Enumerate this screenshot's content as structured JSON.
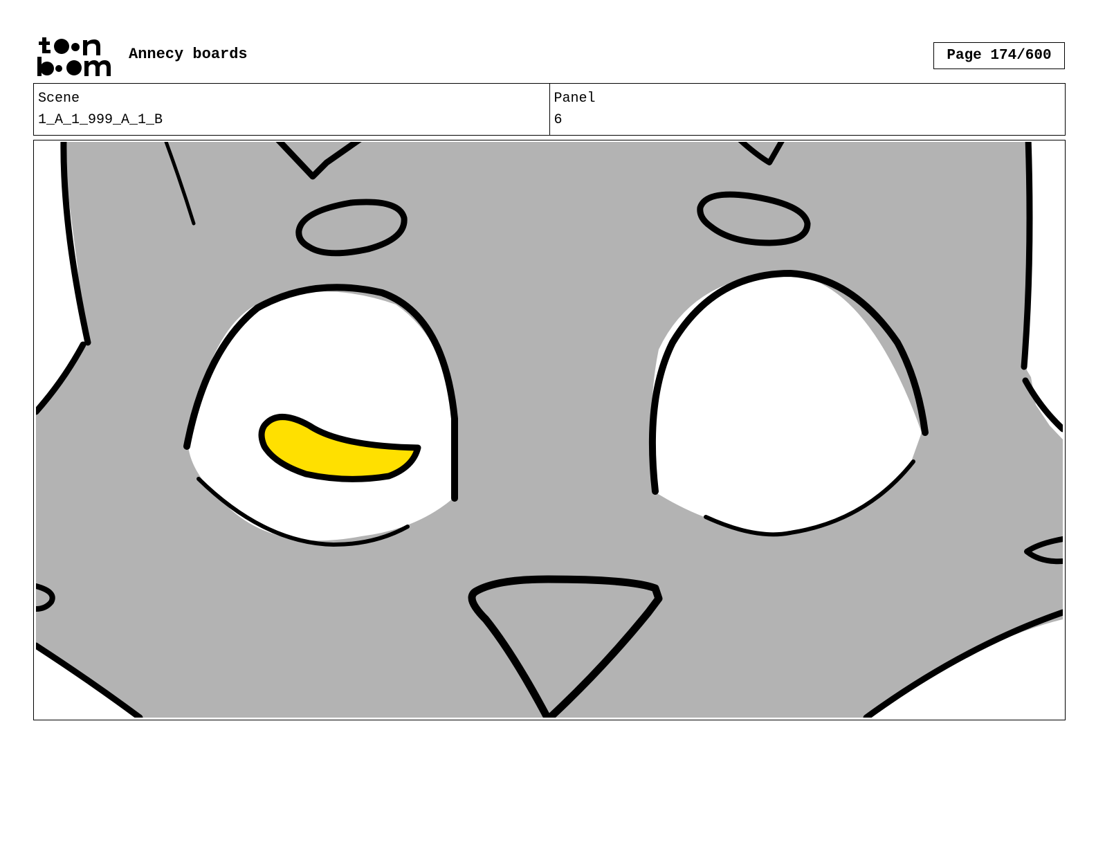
{
  "header": {
    "logo_text": "toonboom",
    "app_title": "Annecy boards",
    "page_label": "Page 174/600"
  },
  "info": {
    "scene_label": "Scene",
    "scene_value": "1_A_1_999_A_1_B",
    "panel_label": "Panel",
    "panel_value": "6"
  },
  "colors": {
    "face_fill": "#b3b3b3",
    "iris_fill": "#ffe000",
    "outline": "#000000"
  }
}
